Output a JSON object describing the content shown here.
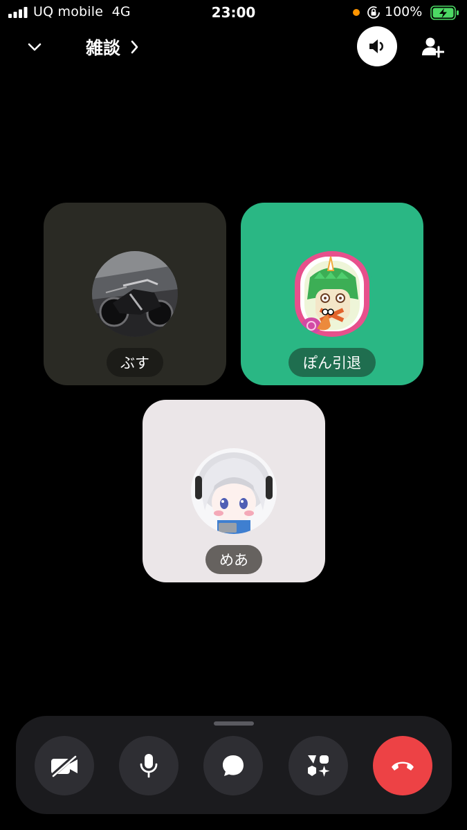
{
  "status_bar": {
    "carrier": "UQ mobile",
    "network": "4G",
    "time": "23:00",
    "battery_percent": "100%",
    "battery_level": 1.0,
    "battery_color": "#4cd964",
    "privacy_dot_color": "#ff9500"
  },
  "header": {
    "channel_name": "雑談",
    "collapse_icon": "chevron-down-icon",
    "channel_arrow_icon": "chevron-right-icon",
    "speaker_icon": "speaker-icon",
    "add_user_icon": "add-user-icon"
  },
  "participants": [
    {
      "name": "ぶす",
      "tile_color": "#2a2a24",
      "avatar": "motorcycle-photo"
    },
    {
      "name": "ぽん引退",
      "tile_color": "#2ab784",
      "avatar": "pixel-art-owl-snail"
    },
    {
      "name": "めあ",
      "tile_color": "#ebe6e8",
      "avatar": "anime-character"
    }
  ],
  "controls": {
    "camera_icon": "camera-off-icon",
    "mic_icon": "microphone-icon",
    "chat_icon": "chat-bubble-icon",
    "activities_icon": "activities-icon",
    "hangup_icon": "hang-up-icon",
    "hangup_color": "#ed4245"
  }
}
